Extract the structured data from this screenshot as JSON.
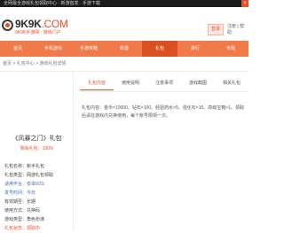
{
  "topbar": {
    "notice": "全网最全游戏礼包领取中心 · 新游首发 · 手游下载",
    "close_label": "×"
  },
  "header": {
    "logo_main": "9K9K",
    "logo_com": ".COM",
    "logo_sub": "9K9K手游网 · 游戏门户",
    "badge": "登录",
    "info": "注册 | 帮助"
  },
  "nav": {
    "items": [
      {
        "label": "首页"
      },
      {
        "label": "手机游戏"
      },
      {
        "label": "手游攻略"
      },
      {
        "label": "新游"
      },
      {
        "label": "礼包"
      },
      {
        "label": "排行"
      },
      {
        "label": "专题"
      }
    ],
    "active_index": 4
  },
  "breadcrumb": "首页 > 礼包中心 > 游戏礼包详情",
  "sidebar": {
    "game_title": "《风暴之门》礼包",
    "game_tag": "剩余礼包：100%",
    "info_rows": [
      {
        "text": "礼包名称：新手礼包",
        "style": ""
      },
      {
        "text": "礼包类型：网游礼包领取",
        "style": ""
      },
      {
        "text": "适用平台：安卓/iOS",
        "style": "link"
      },
      {
        "text": "发号时间：今日",
        "style": "link"
      },
      {
        "text": "有效期至：长期",
        "style": ""
      },
      {
        "text": "使用方式：兑换码",
        "style": ""
      },
      {
        "text": "游戏类型：角色扮演",
        "style": ""
      },
      {
        "text": "礼包状态：领取中",
        "style": "hot"
      }
    ]
  },
  "tabs": [
    {
      "label": "礼包内容"
    },
    {
      "label": "使用说明"
    },
    {
      "label": "注意事项"
    },
    {
      "label": "游戏截图"
    },
    {
      "label": "相关礼包"
    }
  ],
  "content": {
    "description": "礼包内容：金币×10000、钻石×100、经验药水×5、强化石×10、高级宝箱×1。领取后请在游戏内兑换使用，每个账号限领一次。"
  }
}
